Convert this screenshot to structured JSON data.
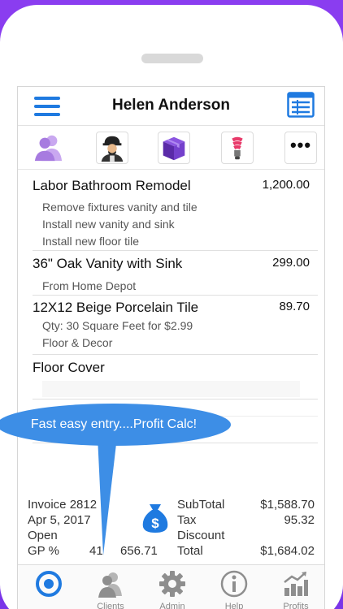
{
  "header": {
    "title": "Helen Anderson"
  },
  "toolbar": {
    "icons": [
      {
        "name": "client-icon"
      },
      {
        "name": "worker-icon"
      },
      {
        "name": "box-icon"
      },
      {
        "name": "lightbulb-icon"
      },
      {
        "name": "more-icon",
        "label": "•••"
      }
    ]
  },
  "items": [
    {
      "name": "Labor  Bathroom Remodel",
      "amount": "1,200.00",
      "details": [
        "Remove fixtures vanity and tile",
        "Install new vanity and sink",
        "Install new floor tile"
      ]
    },
    {
      "name": "36\" Oak Vanity with Sink",
      "amount": "299.00",
      "details": [
        "From Home Depot"
      ]
    },
    {
      "name": "12X12 Beige Porcelain Tile",
      "amount": "89.70",
      "details": [
        "Qty: 30 Square Feet for $2.99",
        "Floor & Decor"
      ]
    },
    {
      "name": "Floor Cover",
      "amount": "",
      "details": []
    }
  ],
  "callout": "Fast easy entry....Profit Calc!",
  "summary": {
    "invoice": "Invoice 2812",
    "date": "Apr 5, 2017",
    "status": "Open",
    "gp_label": "GP %",
    "gp_percent": "41",
    "gp_amount": "656.71",
    "subtotal_label": "SubTotal",
    "subtotal": "$1,588.70",
    "tax_label": "Tax",
    "tax": "95.32",
    "discount_label": "Discount",
    "discount": "",
    "total_label": "Total",
    "total": "$1,684.02"
  },
  "tabs": [
    {
      "label": "",
      "icon": "target-icon",
      "active": true
    },
    {
      "label": "Clients",
      "icon": "clients-icon"
    },
    {
      "label": "Admin",
      "icon": "gear-icon"
    },
    {
      "label": "Help",
      "icon": "info-icon"
    },
    {
      "label": "Profits",
      "icon": "profits-chart-icon"
    }
  ],
  "colors": {
    "accent": "#1f7ae0",
    "callout": "#3d8ee6",
    "background": "#8a3df0"
  }
}
